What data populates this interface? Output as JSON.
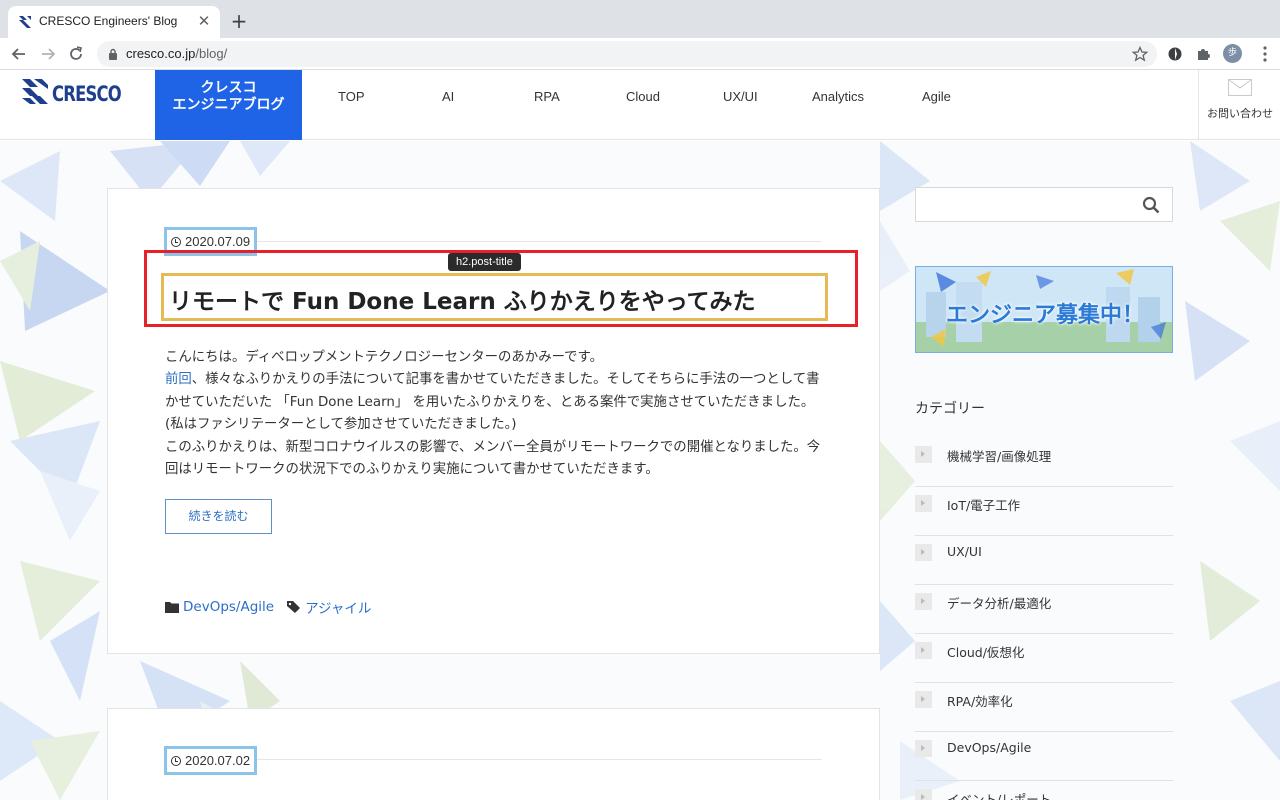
{
  "browser": {
    "tab_title": "CRESCO Engineers' Blog",
    "url_host": "cresco.co.jp",
    "url_path": "/blog/",
    "profile_initial": "歩"
  },
  "header": {
    "logo_text": "CRESCO",
    "blog_badge_line1": "クレスコ",
    "blog_badge_line2": "エンジニアブログ",
    "nav": [
      "TOP",
      "AI",
      "RPA",
      "Cloud",
      "UX/UI",
      "Analytics",
      "Agile"
    ],
    "contact_label": "お問い合わせ"
  },
  "colors": {
    "brand_blue": "#1f64e6",
    "link_blue": "#2d6fc4",
    "highlight_red": "#e8202a",
    "highlight_yellow": "#e6bb57",
    "highlight_lightblue": "#8cc3ea"
  },
  "posts": [
    {
      "date": "2020.07.09",
      "title": "リモートで Fun Done Learn ふりかえりをやってみた",
      "inspector_tag": "h2.post-title",
      "excerpt_line1": "こんにちは。ディベロップメントテクノロジーセンターのあかみーです。",
      "excerpt_link": "前回",
      "excerpt_rest": "、様々なふりかえりの手法について記事を書かせていただきました。そしてそちらに手法の一つとして書かせていただいた 「Fun Done Learn」 を用いたふりかえりを、とある案件で実施させていただきました。(私はファシリテーターとして参加させていただきました。)",
      "excerpt_para2": "このふりかえりは、新型コロナウイルスの影響で、メンバー全員がリモートワークでの開催となりました。今回はリモートワークの状況下でのふりかえり実施について書かせていただきます。",
      "read_more": "続きを読む",
      "category": "DevOps/Agile",
      "tag": "アジャイル"
    },
    {
      "date": "2020.07.02"
    }
  ],
  "sidebar": {
    "search_placeholder": "",
    "banner_text": "エンジニア募集中！",
    "categories_heading": "カテゴリー",
    "categories": [
      "機械学習/画像処理",
      "IoT/電子工作",
      "UX/UI",
      "データ分析/最適化",
      "Cloud/仮想化",
      "RPA/効率化",
      "DevOps/Agile",
      "イベント/レポート"
    ]
  }
}
